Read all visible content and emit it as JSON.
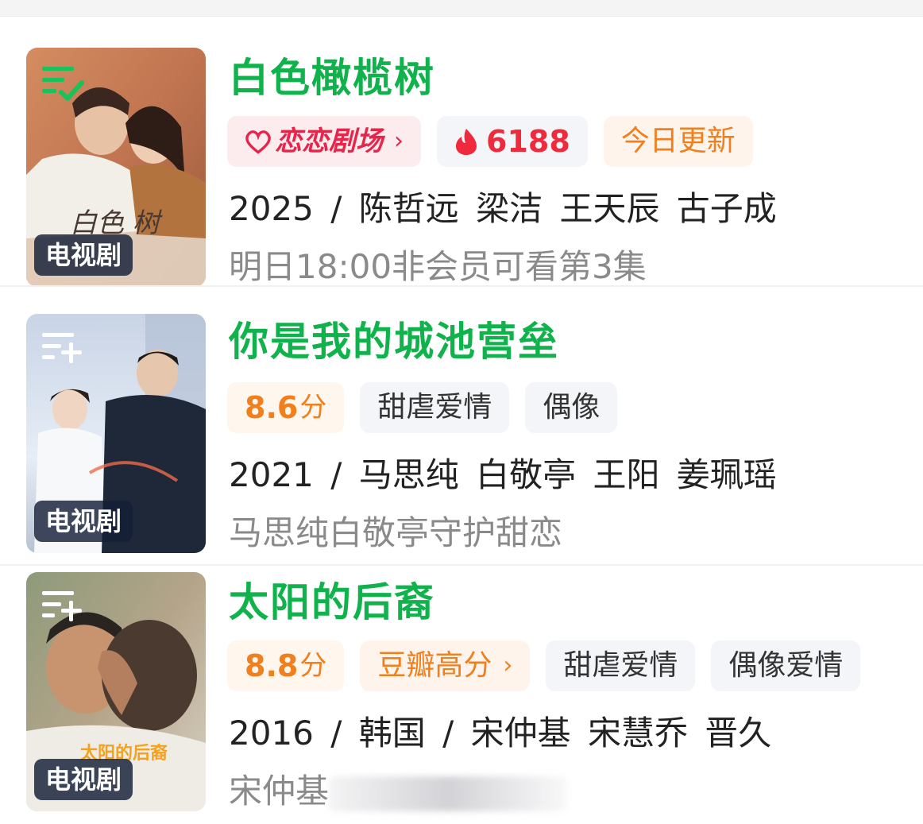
{
  "items": [
    {
      "title": "白色橄榄树",
      "poster_badge": "电视剧",
      "poster_icon": "list-check-icon",
      "poster_text": "白色   树",
      "tags": {
        "brand": "恋恋剧场",
        "heat": "6188",
        "update": "今日更新"
      },
      "meta": "2025 / 陈哲远  梁洁  王天辰  古子成",
      "subtitle": "明日18:00非会员可看第3集"
    },
    {
      "title": "你是我的城池营垒",
      "poster_badge": "电视剧",
      "poster_icon": "add-list-icon",
      "tags": {
        "rating": "8.6",
        "rating_unit": "分",
        "genre": "甜虐爱情",
        "genre2": "偶像"
      },
      "meta": "2021 / 马思纯  白敬亭  王阳  姜珮瑶",
      "subtitle": "马思纯白敬亭守护甜恋"
    },
    {
      "title": "太阳的后裔",
      "poster_badge": "电视剧",
      "poster_icon": "add-list-icon",
      "poster_text": "太阳的后裔",
      "tags": {
        "rating": "8.8",
        "rating_unit": "分",
        "douban": "豆瓣高分",
        "genre": "甜虐爱情",
        "genre2": "偶像爱情"
      },
      "meta": "2016 / 韩国 / 宋仲基  宋慧乔  晋久",
      "subtitle": "宋仲基"
    }
  ],
  "colors": {
    "title": "#10b34b",
    "orange": "#f07f1d",
    "heat": "#ef2a3c",
    "brand": "#e8244b"
  }
}
